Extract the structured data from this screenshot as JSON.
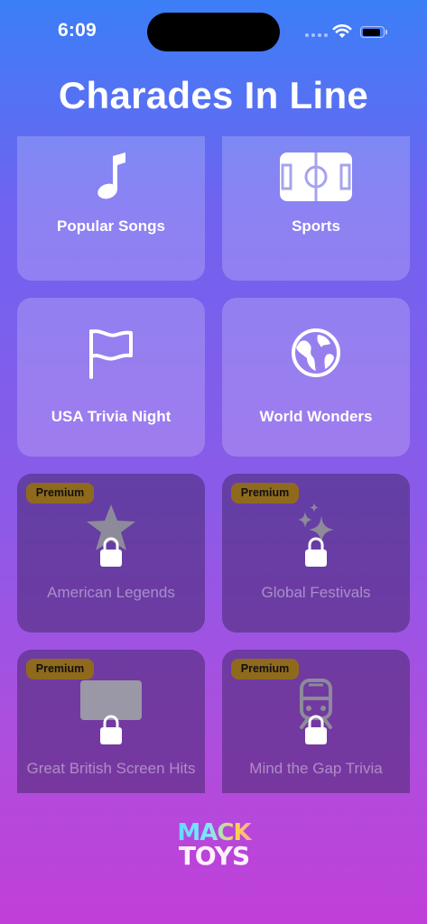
{
  "status_bar": {
    "time": "6:09"
  },
  "title": "Charades In Line",
  "categories": [
    {
      "label": "Popular Songs",
      "icon": "music-note-icon",
      "locked": false
    },
    {
      "label": "Sports",
      "icon": "soccer-field-icon",
      "locked": false
    },
    {
      "label": "USA Trivia Night",
      "icon": "flag-icon",
      "locked": false
    },
    {
      "label": "World Wonders",
      "icon": "globe-icon",
      "locked": false
    },
    {
      "label": "American Legends",
      "icon": "star-icon",
      "locked": true,
      "badge": "Premium"
    },
    {
      "label": "Global Festivals",
      "icon": "sparkles-icon",
      "locked": true,
      "badge": "Premium"
    },
    {
      "label": "Great British Screen Hits",
      "icon": "tv-screen-icon",
      "locked": true,
      "badge": "Premium"
    },
    {
      "label": "Mind the Gap Trivia",
      "icon": "train-icon",
      "locked": true,
      "badge": "Premium"
    }
  ],
  "brand": {
    "line1": "MACK",
    "line2": "TOYS"
  },
  "colors": {
    "badge_background": "#8f6a1c",
    "gradient_top": "#3b7ff7",
    "gradient_bottom": "#c03fd8"
  }
}
